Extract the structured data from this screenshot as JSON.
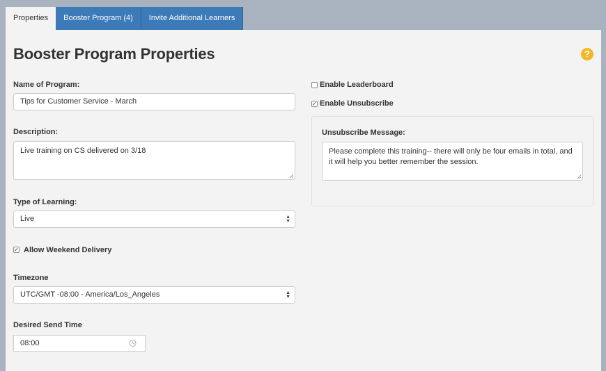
{
  "tabs": [
    {
      "label": "Properties",
      "active": true
    },
    {
      "label": "Booster Program (4)",
      "active": false
    },
    {
      "label": "Invite Additional Learners",
      "active": false
    }
  ],
  "page_title": "Booster Program Properties",
  "help_icon": {
    "glyph": "?",
    "color": "#f2b925"
  },
  "form": {
    "name": {
      "label": "Name of Program:",
      "value": "Tips for Customer Service - March"
    },
    "description": {
      "label": "Description:",
      "value": "Live training on CS delivered on 3/18"
    },
    "learning_type": {
      "label": "Type of Learning:",
      "value": "Live"
    },
    "weekend": {
      "label": "Allow Weekend Delivery",
      "checked": true
    },
    "timezone": {
      "label": "Timezone",
      "value": "UTC/GMT -08:00 - America/Los_Angeles"
    },
    "send_time": {
      "label": "Desired Send Time",
      "value": "08:00"
    }
  },
  "options": {
    "leaderboard": {
      "label": "Enable Leaderboard",
      "checked": false
    },
    "unsubscribe": {
      "label": "Enable Unsubscribe",
      "checked": true
    },
    "unsubscribe_message": {
      "label": "Unsubscribe Message:",
      "value": "Please complete this training-- there will only be four emails in total, and it will help you better remember the session."
    }
  },
  "colors": {
    "tab_blue": "#3c7ab8",
    "panel_bg": "#f3f3f3",
    "frame_bg": "#a9b3bf",
    "help_yellow": "#f2b925"
  }
}
